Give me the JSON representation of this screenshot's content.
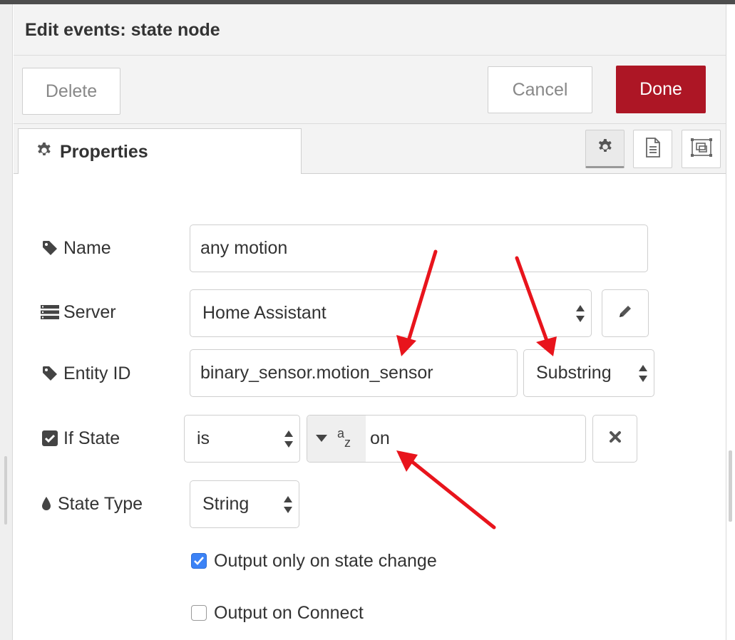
{
  "dialog": {
    "title": "Edit events: state node"
  },
  "toolbar": {
    "delete_label": "Delete",
    "cancel_label": "Cancel",
    "done_label": "Done"
  },
  "tabs": {
    "properties_label": "Properties",
    "icons": [
      "gear-icon",
      "description-icon",
      "appearance-icon"
    ]
  },
  "form": {
    "name": {
      "label": "Name",
      "value": "any motion"
    },
    "server": {
      "label": "Server",
      "value": "Home Assistant"
    },
    "entity_id": {
      "label": "Entity ID",
      "value": "binary_sensor.motion_sensor",
      "match_mode": "Substring"
    },
    "if_state": {
      "label": "If State",
      "operator": "is",
      "type_glyph_top": "a",
      "type_glyph_bottom": "z",
      "value": "on"
    },
    "state_type": {
      "label": "State Type",
      "value": "String"
    },
    "output_state_change": {
      "label": "Output only on state change",
      "checked": true
    },
    "output_on_connect": {
      "label": "Output on Connect",
      "checked": false
    }
  },
  "colors": {
    "done": "#ad1625",
    "annotation_arrow": "#e8141c",
    "checkbox": "#3b82f6"
  }
}
